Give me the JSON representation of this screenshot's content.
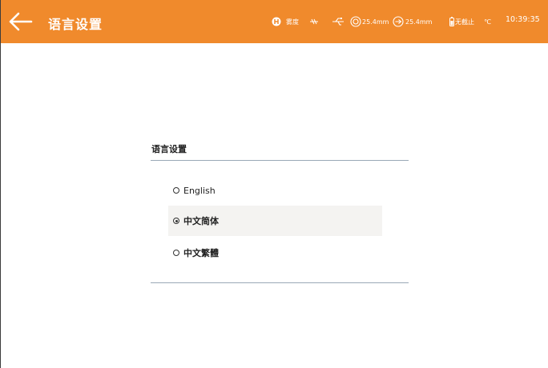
{
  "header": {
    "title": "语言设置",
    "status": {
      "h_label": "雾度",
      "dia1": "25.4mm",
      "dia2": "25.4mm",
      "temp_label": "无截止",
      "temp_unit": "℃",
      "time": "10:39:35"
    },
    "bar_color": "#f08a2c"
  },
  "language_settings": {
    "heading": "语言设置",
    "options": [
      {
        "label": "English",
        "selected": false
      },
      {
        "label": "中文简体",
        "selected": true
      },
      {
        "label": "中文繁體",
        "selected": false
      }
    ]
  },
  "icons": [
    "back-arrow-icon",
    "h-circle-icon",
    "link-icon",
    "usb-icon",
    "target-icon",
    "arrow-circle-icon",
    "battery-icon"
  ]
}
